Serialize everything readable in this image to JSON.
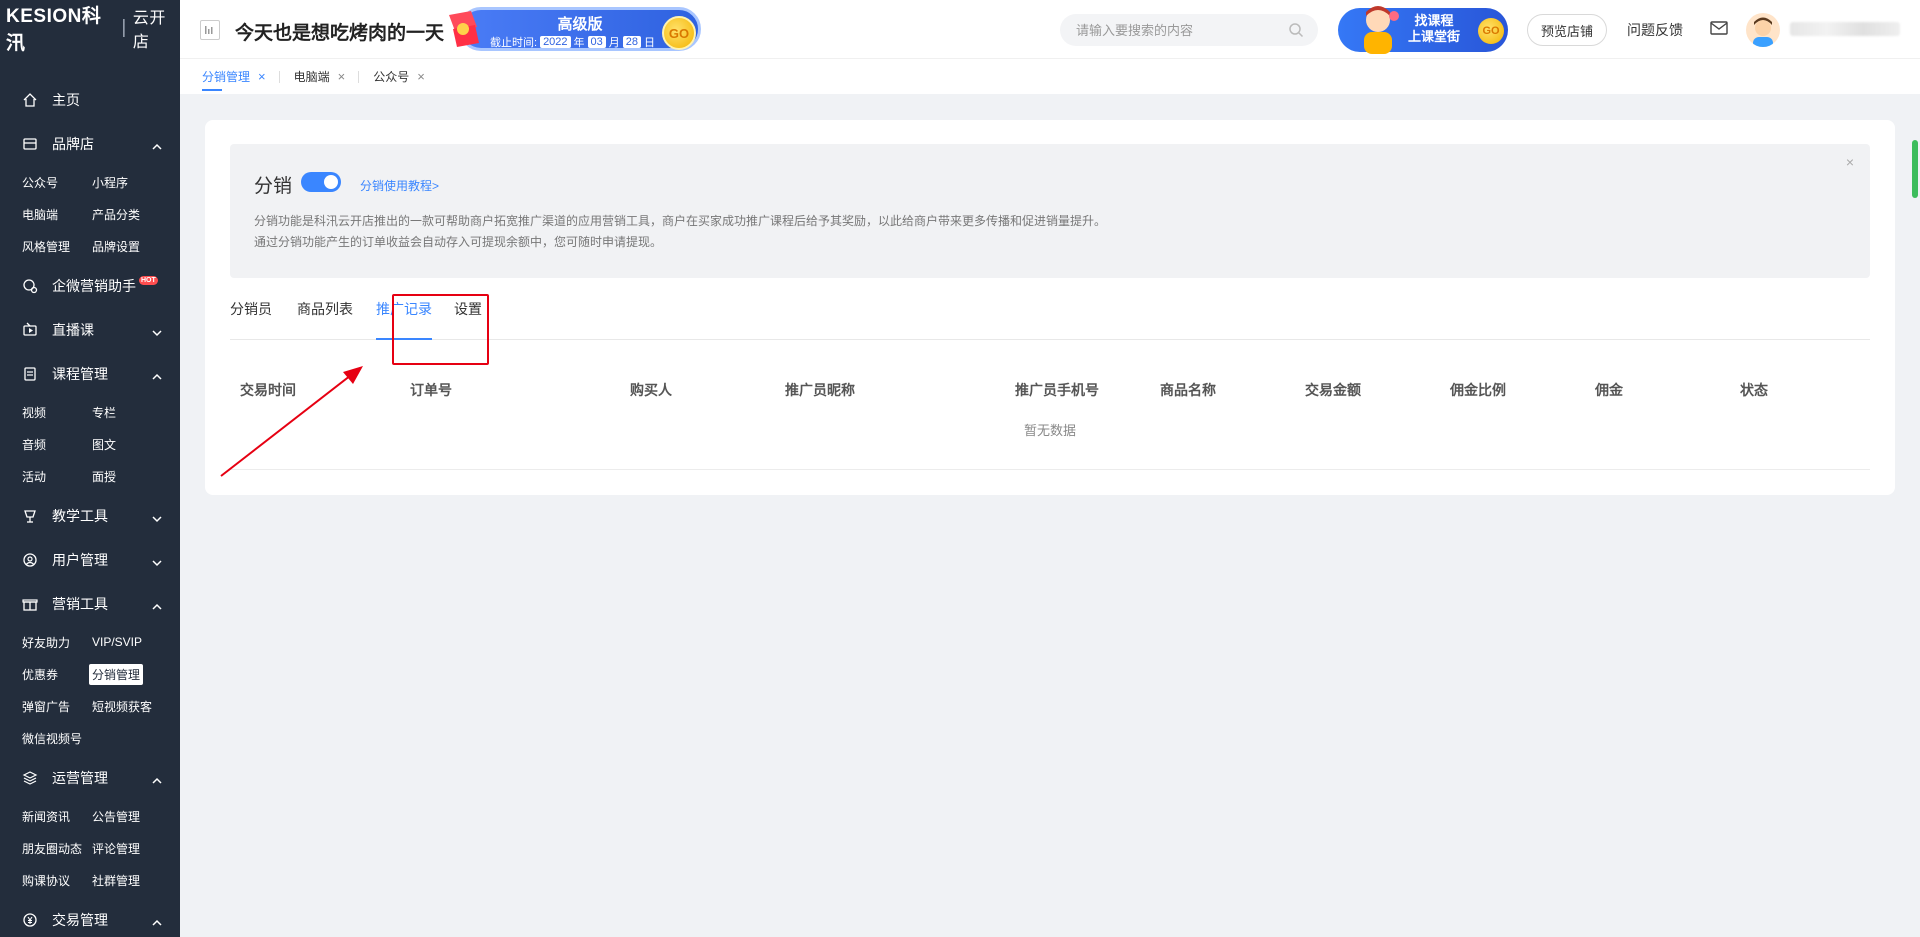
{
  "logo": {
    "brand": "KESION科汛",
    "sub": "云开店"
  },
  "sidebar": {
    "groups": [
      {
        "label": "主页",
        "icon": "home-icon",
        "items": []
      },
      {
        "label": "品牌店",
        "icon": "store-icon",
        "expanded": true,
        "items": [
          "公众号",
          "小程序",
          "电脑端",
          "产品分类",
          "风格管理",
          "品牌设置"
        ]
      },
      {
        "label": "企微营销助手",
        "icon": "chat-icon",
        "badge": "HOT",
        "items": []
      },
      {
        "label": "直播课",
        "icon": "live-icon",
        "expanded": false,
        "items": []
      },
      {
        "label": "课程管理",
        "icon": "course-icon",
        "expanded": true,
        "items": [
          "视频",
          "专栏",
          "音频",
          "图文",
          "活动",
          "面授"
        ]
      },
      {
        "label": "教学工具",
        "icon": "teach-icon",
        "expanded": false,
        "items": []
      },
      {
        "label": "用户管理",
        "icon": "user-icon",
        "expanded": false,
        "items": []
      },
      {
        "label": "营销工具",
        "icon": "gift-icon",
        "expanded": true,
        "items": [
          "好友助力",
          "VIP/SVIP",
          "优惠券",
          "分销管理",
          "弹窗广告",
          "短视频获客",
          "微信视频号"
        ]
      },
      {
        "label": "运营管理",
        "icon": "ops-icon",
        "expanded": true,
        "items": [
          "新闻资讯",
          "公告管理",
          "朋友圈动态",
          "评论管理",
          "购课协议",
          "社群管理"
        ]
      },
      {
        "label": "交易管理",
        "icon": "trade-icon",
        "expanded": true,
        "items": []
      }
    ],
    "active_item": "分销管理"
  },
  "topbar": {
    "store_name": "今天也是想吃烤肉的一天",
    "pro_banner": {
      "title": "高级版",
      "expire_label": "截止时间:",
      "year": "2022",
      "year_unit": "年",
      "month": "03",
      "month_unit": "月",
      "day": "28",
      "day_unit": "日",
      "go": "GO"
    },
    "search_placeholder": "请输入要搜索的内容",
    "find_banner": {
      "line1": "找课程",
      "line2": "上课堂街",
      "go": "GO"
    },
    "preview_label": "预览店铺",
    "feedback_label": "问题反馈"
  },
  "page_tabs": [
    {
      "label": "分销管理",
      "active": true
    },
    {
      "label": "电脑端",
      "active": false
    },
    {
      "label": "公众号",
      "active": false
    }
  ],
  "intro": {
    "title": "分销",
    "tutorial_link": "分销使用教程>",
    "desc1": "分销功能是科汛云开店推出的一款可帮助商户拓宽推广渠道的应用营销工具，商户在买家成功推广课程后给予其奖励，以此给商户带来更多传播和促进销量提升。",
    "desc2": "通过分销功能产生的订单收益会自动存入可提现余额中，您可随时申请提现。",
    "close": "×"
  },
  "content_tabs": [
    {
      "label": "分销员",
      "active": false
    },
    {
      "label": "商品列表",
      "active": false
    },
    {
      "label": "推广记录",
      "active": true
    },
    {
      "label": "设置",
      "active": false
    }
  ],
  "table": {
    "columns": [
      "交易时间",
      "订单号",
      "购买人",
      "推广员昵称",
      "推广员手机号",
      "商品名称",
      "交易金额",
      "佣金比例",
      "佣金",
      "状态"
    ],
    "empty_text": "暂无数据"
  },
  "colors": {
    "sidebar_bg": "#232d3c",
    "accent": "#3a86ff",
    "highlight": "#e60012"
  }
}
